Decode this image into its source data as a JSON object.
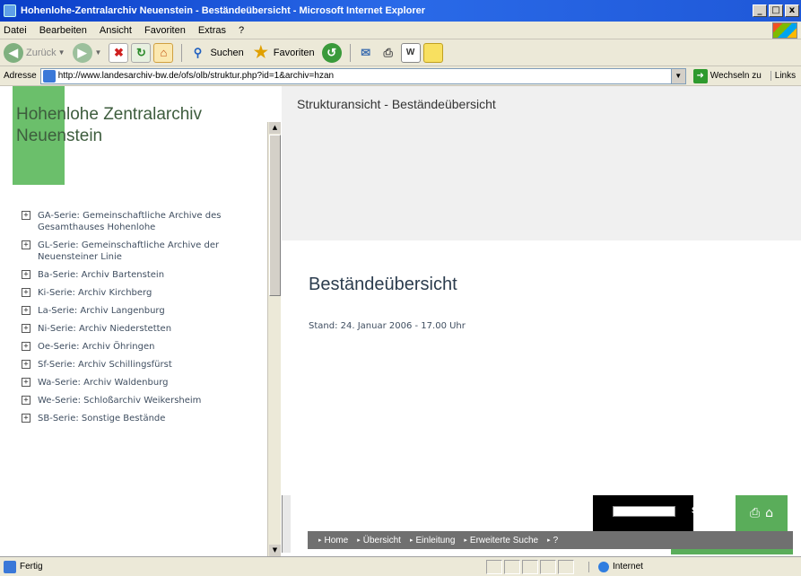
{
  "window": {
    "title": "Hohenlohe-Zentralarchiv Neuenstein - Beständeübersicht - Microsoft Internet Explorer",
    "minimize": "_",
    "maximize": "□",
    "close": "x"
  },
  "menu": [
    "Datei",
    "Bearbeiten",
    "Ansicht",
    "Favoriten",
    "Extras",
    "?"
  ],
  "toolbar": {
    "back": "Zurück",
    "search": "Suchen",
    "favorites": "Favoriten"
  },
  "address": {
    "label": "Adresse",
    "url": "http://www.landesarchiv-bw.de/ofs/olb/struktur.php?id=1&archiv=hzan",
    "go": "Wechseln zu",
    "links": "Links"
  },
  "left": {
    "archive_title": "Hohenlohe Zentralarchiv Neuenstein",
    "tree": [
      "GA-Serie: Gemeinschaftliche Archive des Gesamthauses Hohenlohe",
      "GL-Serie: Gemeinschaftliche Archive der Neuensteiner Linie",
      "Ba-Serie: Archiv Bartenstein",
      "Ki-Serie: Archiv Kirchberg",
      "La-Serie: Archiv Langenburg",
      "Ni-Serie: Archiv Niederstetten",
      "Oe-Serie: Archiv Öhringen",
      "Sf-Serie: Archiv Schillingsfürst",
      "Wa-Serie: Archiv Waldenburg",
      "We-Serie: Schloßarchiv Weikersheim",
      "SB-Serie: Sonstige Bestände"
    ]
  },
  "right": {
    "struct_title": "Strukturansicht - Beständeübersicht",
    "heading": "Beständeübersicht",
    "stand": "Stand: 24. Januar 2006 - 17.00 Uhr",
    "search_label": "Suche",
    "nav": [
      "Home",
      "Übersicht",
      "Einleitung",
      "Erweiterte Suche",
      "?"
    ]
  },
  "status": {
    "text": "Fertig",
    "zone": "Internet"
  }
}
